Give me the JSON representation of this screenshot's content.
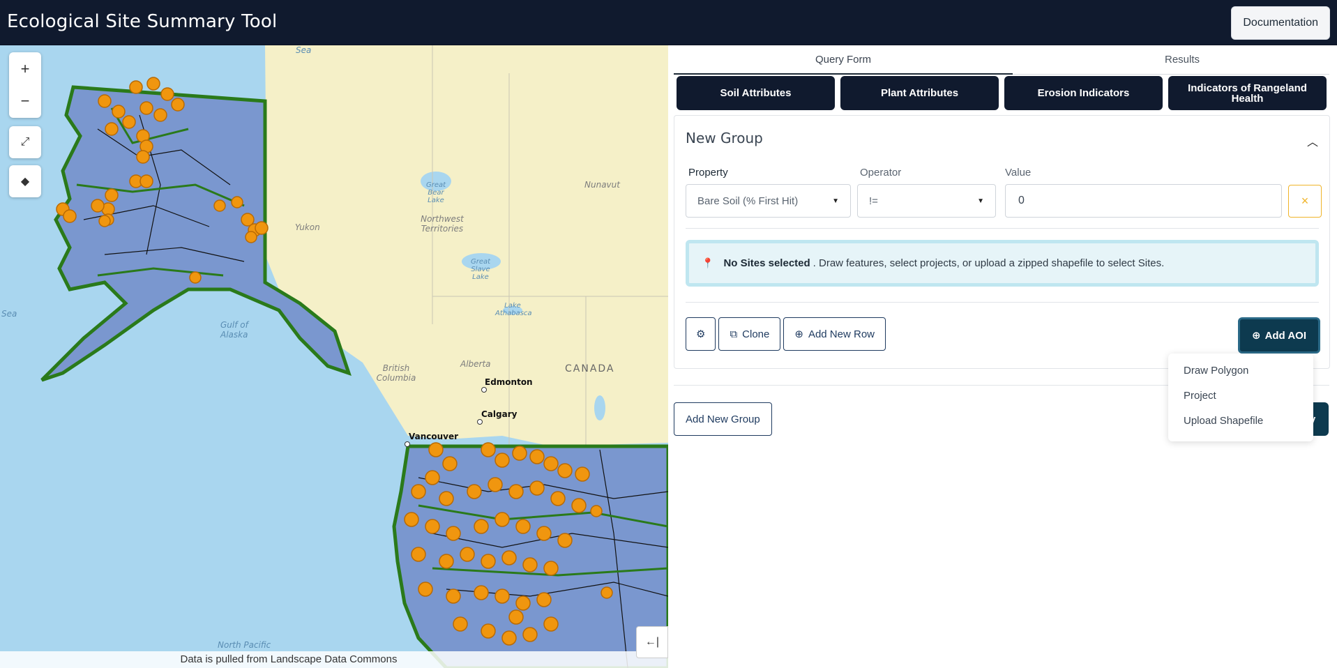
{
  "header": {
    "title": "Ecological Site Summary Tool",
    "documentation_label": "Documentation"
  },
  "map": {
    "zoom_in": "+",
    "zoom_out": "−",
    "fullscreen_icon": "expand-icon",
    "layers_icon": "layers-icon",
    "collapse_label": "←|",
    "attribution": "Data is pulled from Landscape Data Commons",
    "labels": {
      "sea_top": "Sea",
      "sea_left": "Sea",
      "gulf": "Gulf of Alaska",
      "north_pacific": "North Pacific",
      "great_bear": "Great Bear Lake",
      "great_slave": "Great Slave Lake",
      "lake_athabasca": "Lake Athabasca",
      "nunavut": "Nunavut",
      "yukon": "Yukon",
      "nwt": "Northwest Territories",
      "bc": "British Columbia",
      "alberta": "Alberta",
      "canada": "CANADA",
      "edmonton": "Edmonton",
      "calgary": "Calgary",
      "vancouver": "Vancouver"
    },
    "colors": {
      "ocean": "#a9d6ef",
      "land": "#f5f0c8",
      "region_fill": "#7a97cf",
      "region_border": "#2a7a1a",
      "site_points": "#f0960f"
    }
  },
  "panel": {
    "tabs": [
      "Query Form",
      "Results"
    ],
    "active_tab": "Query Form",
    "categories": [
      "Soil Attributes",
      "Plant Attributes",
      "Erosion Indicators",
      "Indicators of Rangeland Health"
    ],
    "group": {
      "title": "New Group",
      "property_label": "Property",
      "operator_label": "Operator",
      "value_label": "Value",
      "property_value": "Bare Soil (% First Hit)",
      "operator_value": "!=",
      "value_value": "0",
      "remove_label": "×"
    },
    "alert": {
      "bold": "No Sites selected",
      "text": ". Draw features, select projects, or upload a zipped shapefile to select Sites."
    },
    "toolbar": {
      "settings_icon": "sliders-icon",
      "clone_label": "Clone",
      "add_row_label": "Add New Row",
      "add_aoi_label": "Add AOI"
    },
    "aoi_menu": [
      "Draw Polygon",
      "Project",
      "Upload Shapefile"
    ],
    "add_group_label": "Add New Group",
    "obscured_button_label": "y"
  }
}
